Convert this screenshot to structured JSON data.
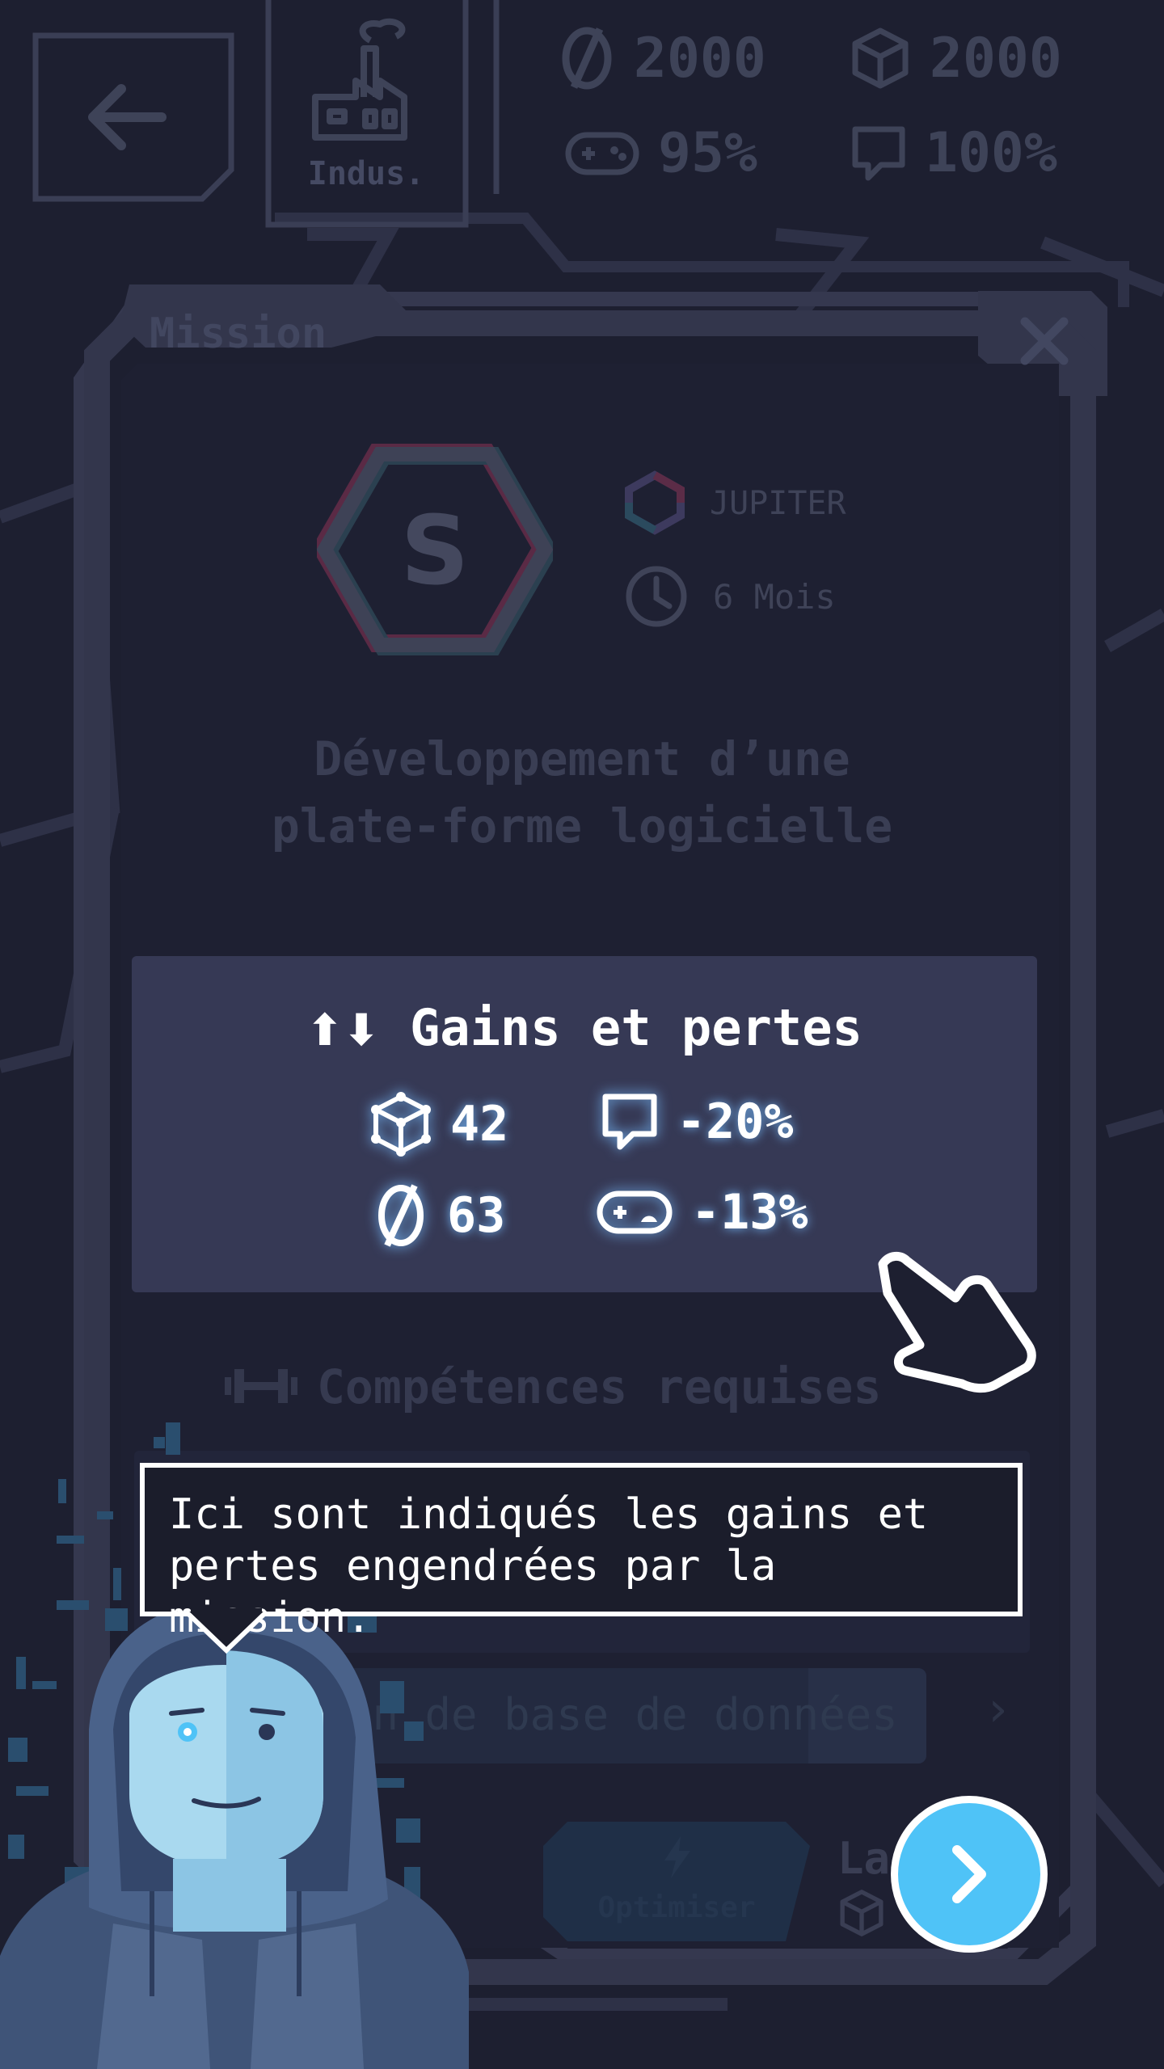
{
  "header": {
    "back_label": "←",
    "category_label": "Indus.",
    "stats": {
      "money": "2000",
      "knowledge": "2000",
      "satisfaction": "95%",
      "reputation": "100%"
    }
  },
  "mission_card": {
    "tab_label": "Mission",
    "close_label": "✕",
    "grade": "S",
    "client": "JUPITER",
    "duration": "6 Mois",
    "title_line1": "Développement d’une",
    "title_line2": "plate-forme logicielle"
  },
  "gains_losses": {
    "title": "Gains et pertes",
    "arrows": "⬆⬇",
    "knowledge": "42",
    "reputation": "-20%",
    "money": "63",
    "satisfaction": "-13%"
  },
  "skills": {
    "title": "Compétences requises",
    "row_text": "on de base de données",
    "row_chevron": "›"
  },
  "actions": {
    "optimize_label": "Optimiser",
    "launch_label": "La"
  },
  "tutorial": {
    "bubble_text": "Ici sont indiqués les gains et\npertes engendrées par la mission."
  },
  "colors": {
    "accent": "#4fc3f7",
    "panel": "#363955",
    "background": "#1d1f30"
  },
  "icons": {
    "money": "slashed-coin-icon",
    "knowledge": "cube-icon",
    "satisfaction": "gamepad-icon",
    "reputation": "speech-bubble-icon",
    "duration": "clock-icon",
    "skills": "dumbbell-icon",
    "tutorial_pointer": "hand-pointer-icon",
    "next": "chevron-right-icon"
  }
}
